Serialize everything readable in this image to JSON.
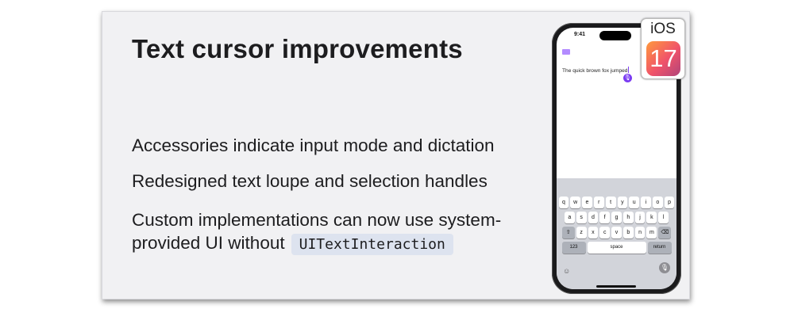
{
  "slide": {
    "title": "Text cursor improvements",
    "bullets": [
      "Accessories indicate input mode and dictation",
      "Redesigned text loupe and selection handles"
    ],
    "bullet3_text": "Custom implementations can now use system-provided UI without",
    "bullet3_code": "UITextInteraction"
  },
  "phone": {
    "status_time": "9:41",
    "typed_text": "The quick brown fox jumped",
    "keyboard": {
      "row1": [
        "q",
        "w",
        "e",
        "r",
        "t",
        "y",
        "u",
        "i",
        "o",
        "p"
      ],
      "row2": [
        "a",
        "s",
        "d",
        "f",
        "g",
        "h",
        "j",
        "k",
        "l"
      ],
      "row3": [
        "⇧",
        "z",
        "x",
        "c",
        "v",
        "b",
        "n",
        "m",
        "⌫"
      ],
      "numbers_key": "123",
      "space_key": "space",
      "return_key": "return"
    },
    "icons": {
      "shift": "shift-icon",
      "delete": "delete-icon",
      "emoji": "emoji-icon",
      "mic": "microphone-icon"
    }
  },
  "badge": {
    "os": "iOS",
    "version": "17"
  }
}
